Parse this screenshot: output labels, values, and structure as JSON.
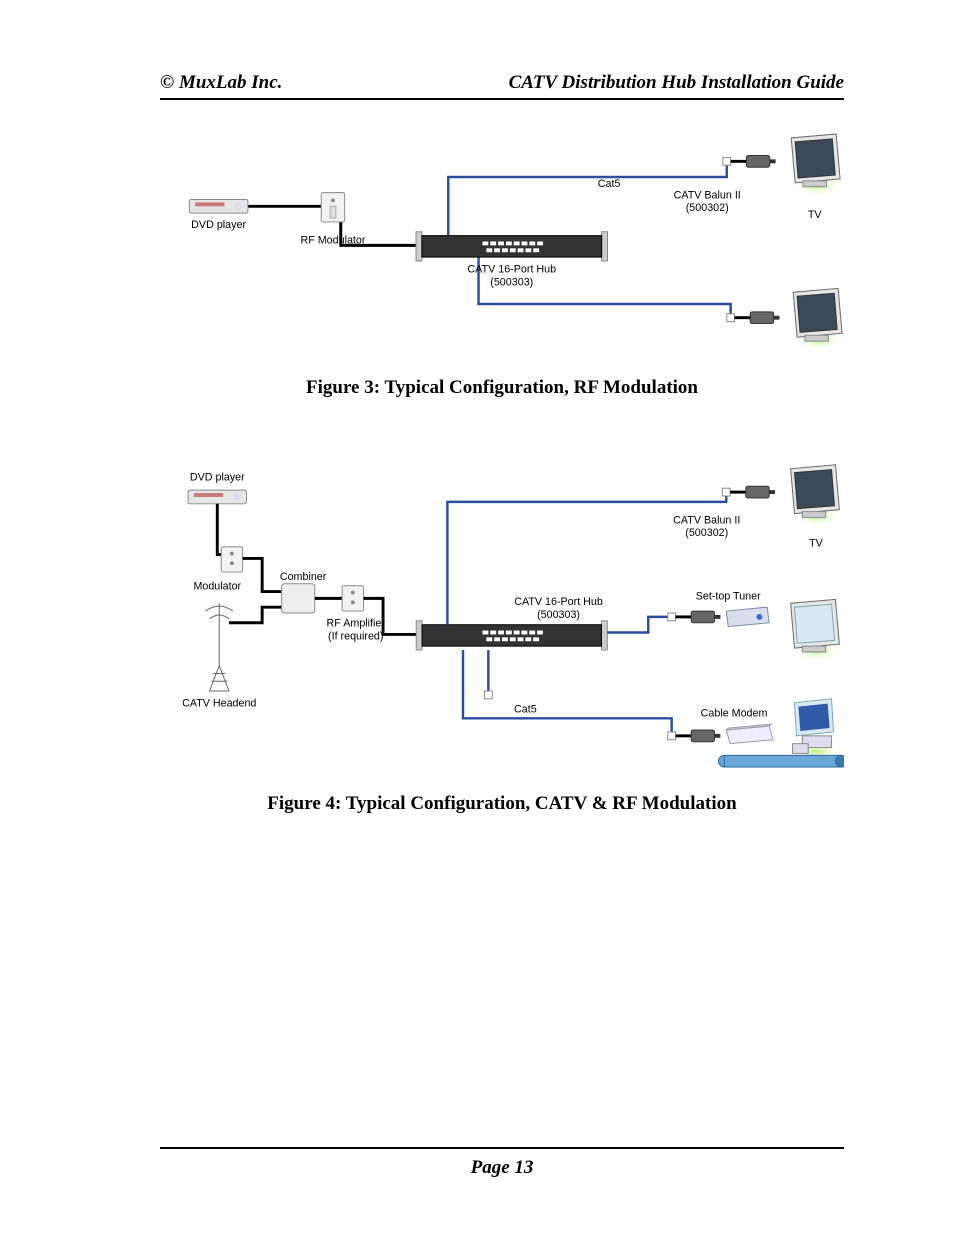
{
  "header": {
    "left": "© MuxLab Inc.",
    "right": "CATV Distribution Hub Installation Guide"
  },
  "footer": {
    "page_label": "Page 13"
  },
  "figure3": {
    "caption": "Figure 3: Typical Configuration, RF Modulation",
    "labels": {
      "dvd_player": "DVD player",
      "rf_modulator": "RF Modulator",
      "cat5": "Cat5",
      "hub_line1": "CATV 16-Port Hub",
      "hub_line2": "(500303)",
      "balun_line1": "CATV Balun II",
      "balun_line2": "(500302)",
      "tv": "TV"
    }
  },
  "figure4": {
    "caption": "Figure 4: Typical Configuration, CATV & RF Modulation",
    "labels": {
      "dvd_player": "DVD player",
      "modulator": "Modulator",
      "catv_headend": "CATV Headend",
      "combiner": "Combiner",
      "rf_amp_line1": "RF Amplifier",
      "rf_amp_line2": "(If required)",
      "hub_line1": "CATV 16-Port Hub",
      "hub_line2": "(500303)",
      "cat5": "Cat5",
      "balun_line1": "CATV Balun II",
      "balun_line2": "(500302)",
      "tv": "TV",
      "settop": "Set-top Tuner",
      "cable_modem": "Cable Modem"
    }
  }
}
